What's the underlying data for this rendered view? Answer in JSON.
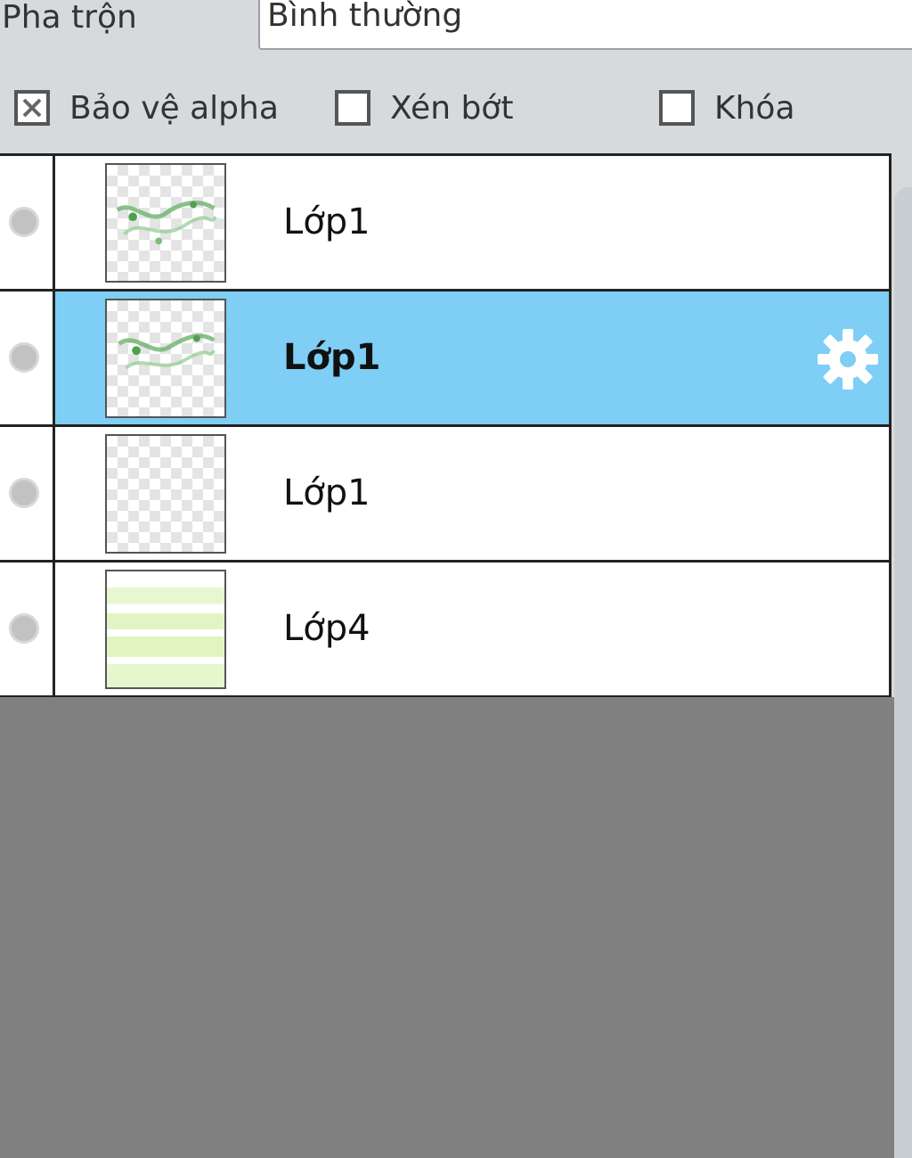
{
  "blend": {
    "label": "Pha trộn",
    "value": "Bình thường"
  },
  "options": [
    {
      "label": "Bảo vệ alpha",
      "checked": true
    },
    {
      "label": "Xén bớt",
      "checked": false
    },
    {
      "label": "Khóa",
      "checked": false
    }
  ],
  "layers": [
    {
      "name": "Lớp1",
      "selected": false
    },
    {
      "name": "Lớp1",
      "selected": true
    },
    {
      "name": "Lớp1",
      "selected": false
    },
    {
      "name": "Lớp4",
      "selected": false
    }
  ],
  "colors": {
    "selected_row": "#7ecef5",
    "panel_bg": "#d6dadd",
    "empty_area": "#808080"
  },
  "icons": {
    "layer_settings": "gear-icon",
    "visibility": "visibility-dot-icon",
    "alpha_check": "x-mark-icon"
  }
}
